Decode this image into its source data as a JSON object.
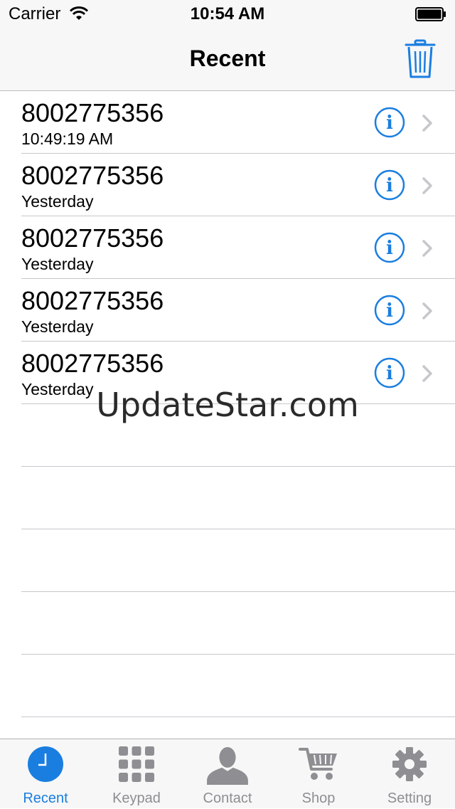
{
  "status_bar": {
    "carrier": "Carrier",
    "time": "10:54 AM"
  },
  "nav": {
    "title": "Recent",
    "trash_icon": "trash-icon"
  },
  "calls": [
    {
      "number": "8002775356",
      "time": "10:49:19 AM"
    },
    {
      "number": "8002775356",
      "time": "Yesterday"
    },
    {
      "number": "8002775356",
      "time": "Yesterday"
    },
    {
      "number": "8002775356",
      "time": "Yesterday"
    },
    {
      "number": "8002775356",
      "time": "Yesterday"
    }
  ],
  "watermark": "UpdateStar.com",
  "tabs": [
    {
      "label": "Recent",
      "icon": "clock-icon",
      "active": true
    },
    {
      "label": "Keypad",
      "icon": "keypad-icon",
      "active": false
    },
    {
      "label": "Contact",
      "icon": "contact-icon",
      "active": false
    },
    {
      "label": "Shop",
      "icon": "cart-icon",
      "active": false
    },
    {
      "label": "Setting",
      "icon": "gear-icon",
      "active": false
    }
  ],
  "colors": {
    "accent": "#1a7ee0",
    "inactive": "#8e8e93",
    "bar_bg": "#f7f7f7",
    "separator": "#c8c7cc"
  }
}
